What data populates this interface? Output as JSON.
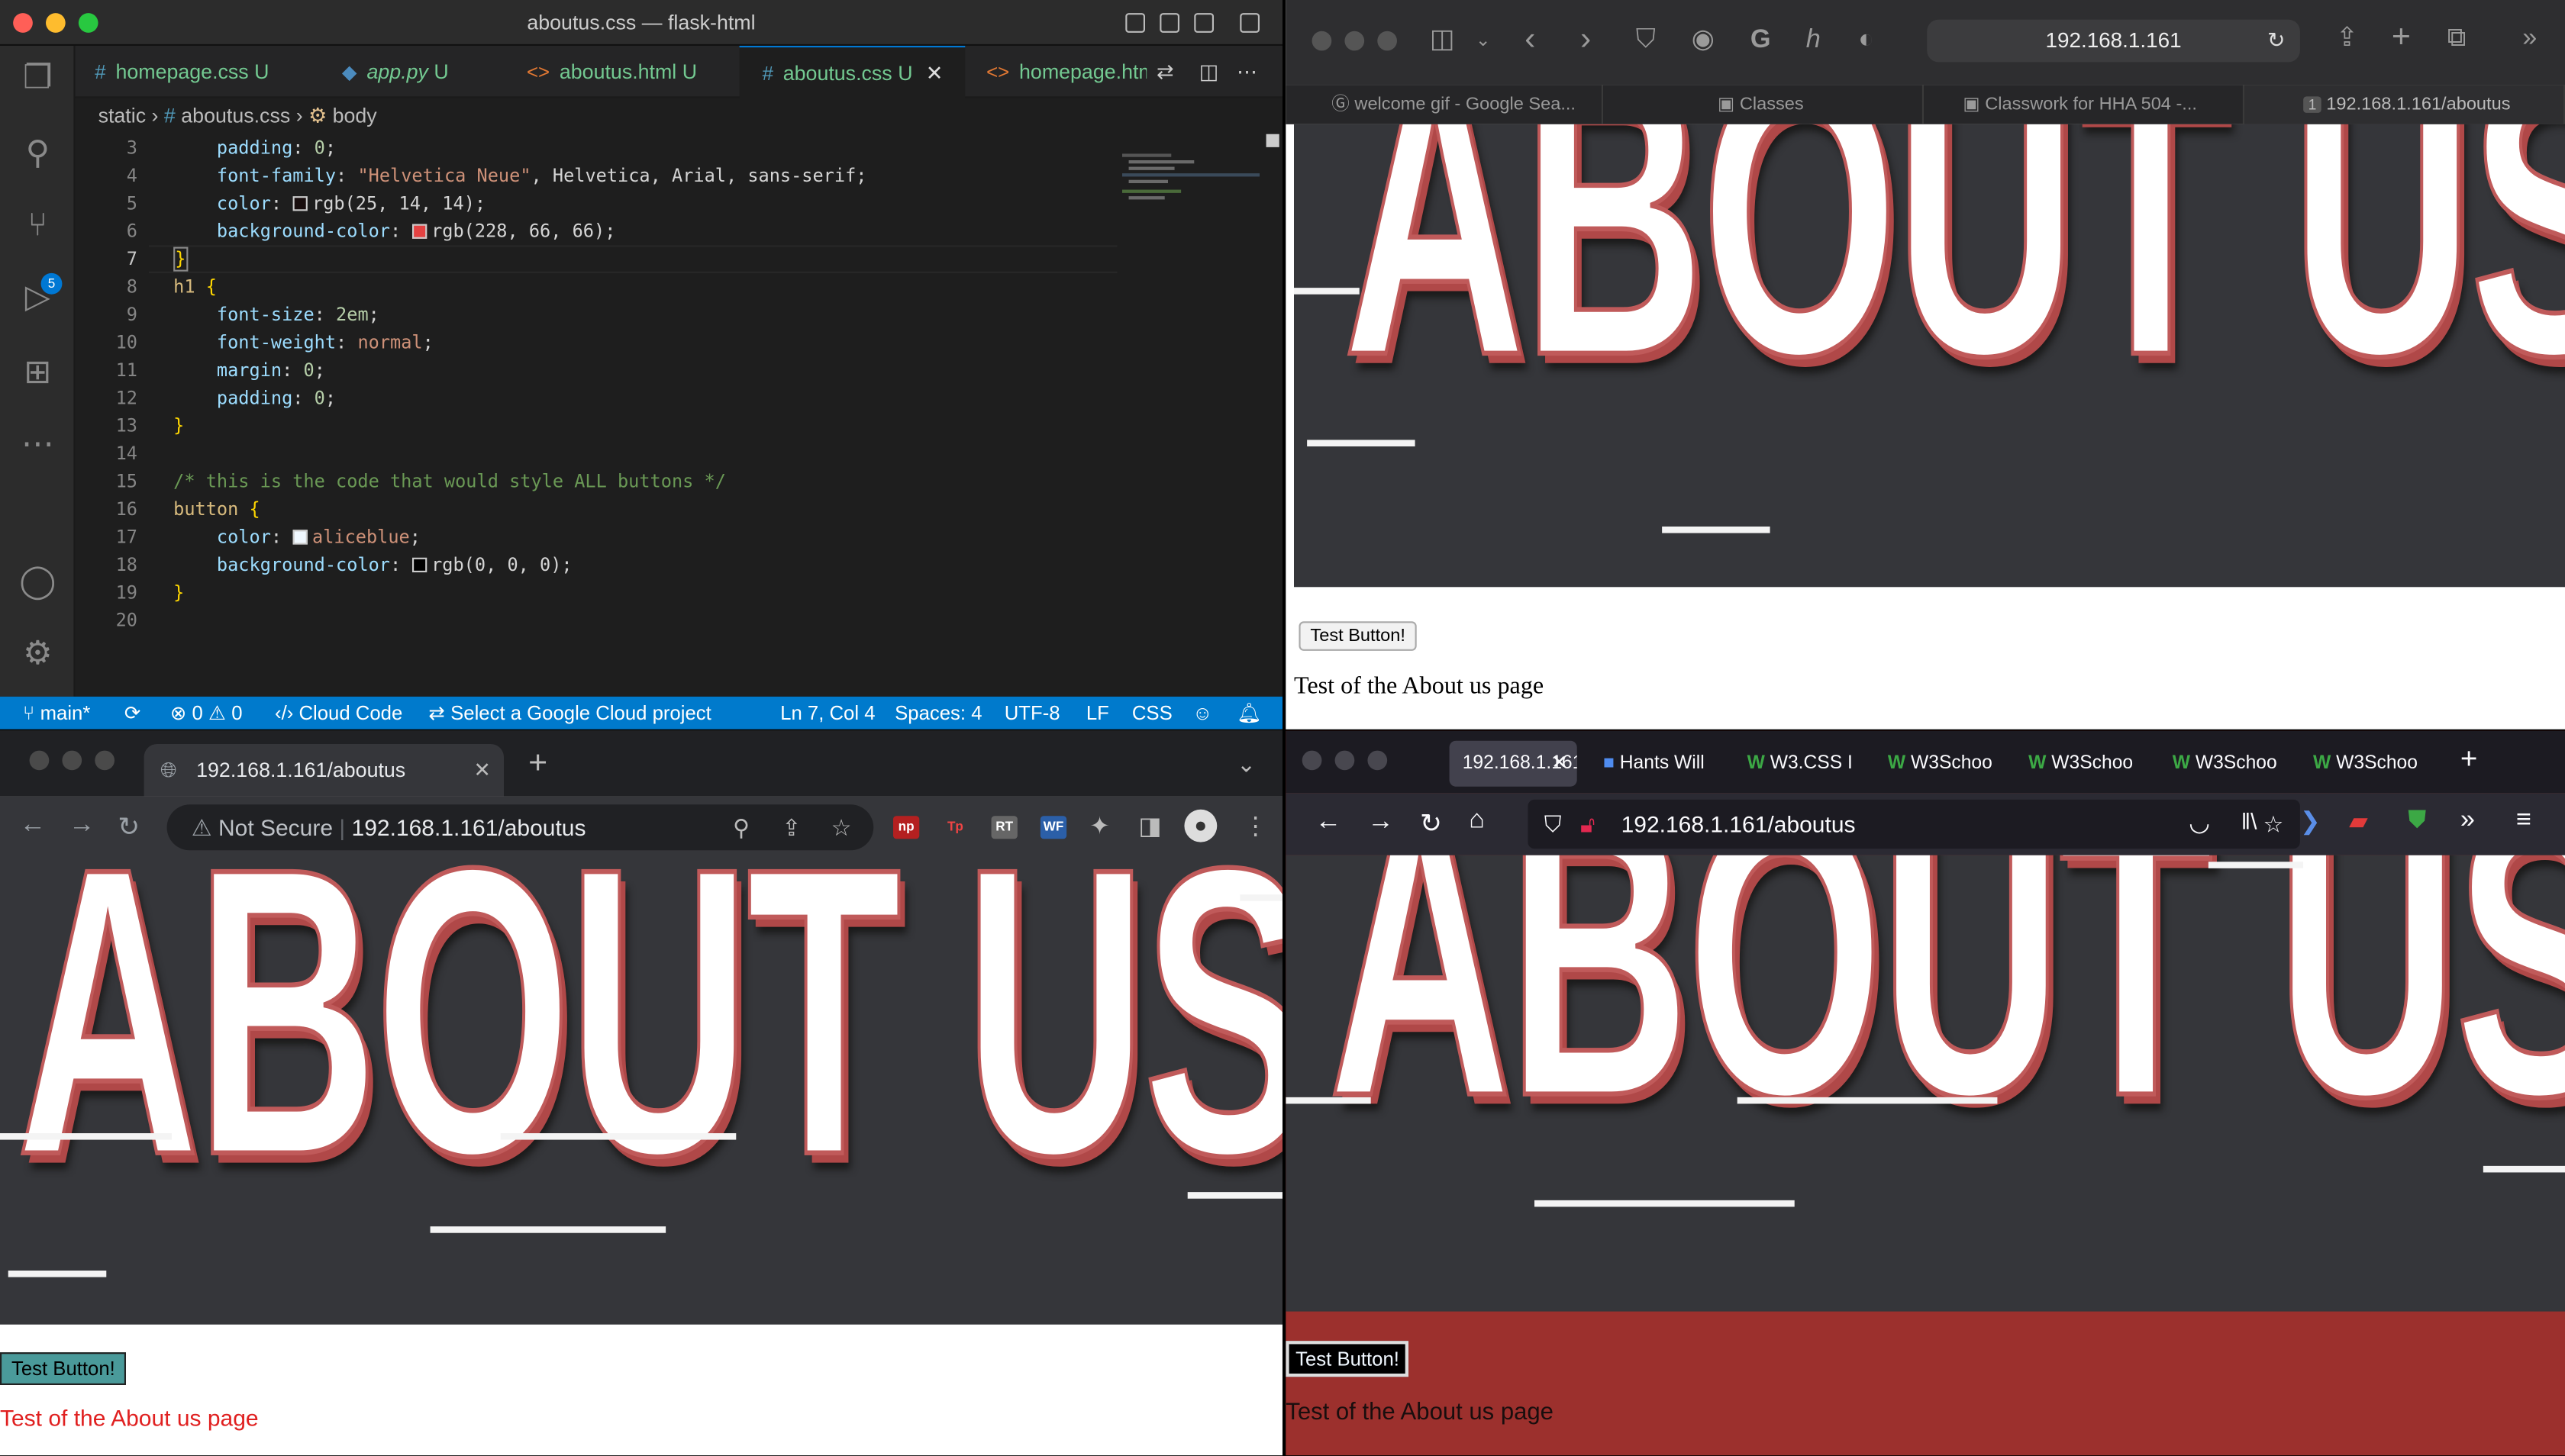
{
  "vscode": {
    "title": "aboutus.css — flask-html",
    "tabs": [
      {
        "icon": "#",
        "label": "homepage.css",
        "badge": "U"
      },
      {
        "icon": "py",
        "label": "app.py",
        "badge": "U"
      },
      {
        "icon": "<>",
        "label": "aboutus.html",
        "badge": "U"
      },
      {
        "icon": "#",
        "label": "aboutus.css",
        "badge": "U",
        "close": "✕"
      },
      {
        "icon": "<>",
        "label": "homepage.htm"
      }
    ],
    "breadcrumb": [
      "static",
      "#",
      "aboutus.css",
      "body"
    ],
    "scm_badge": "5",
    "line_numbers": [
      "3",
      "4",
      "5",
      "6",
      "7",
      "8",
      "9",
      "10",
      "11",
      "12",
      "13",
      "14",
      "15",
      "16",
      "17",
      "18",
      "19",
      "20"
    ],
    "code": {
      "l3_prop": "padding",
      "l3_val": "0",
      "l4_prop": "font-family",
      "l4_str": "\"Helvetica Neue\"",
      "l4_rest": ", Helvetica, Arial, sans-serif",
      "l5_prop": "color",
      "l5_val": "rgb(25, 14, 14)",
      "l6_prop": "background-color",
      "l6_val": "rgb(228, 66, 66)",
      "l7": "}",
      "l8_sel": "h1",
      "open": "{",
      "l9_prop": "font-size",
      "l9_val": "2em",
      "l10_prop": "font-weight",
      "l10_val": "normal",
      "l11_prop": "margin",
      "l11_val": "0",
      "l12_prop": "padding",
      "l12_val": "0",
      "close": "}",
      "l15_comment": "/* this is the code that would style ALL buttons */",
      "l16_sel": "button",
      "l17_prop": "color",
      "l17_val": "aliceblue",
      "l18_prop": "background-color",
      "l18_val": "rgb(0, 0, 0)"
    },
    "status": {
      "branch": "main*",
      "problems": "⊗ 0 ⚠ 0",
      "cloud_code": "Cloud Code",
      "gcp": "Select a Google Cloud project",
      "position": "Ln 7, Col 4",
      "spaces": "Spaces: 4",
      "encoding": "UTF-8",
      "eol": "LF",
      "language": "CSS"
    },
    "colors": {
      "accent": "#007acc",
      "swatch_l5": "#190e0e",
      "swatch_l6": "#e44242",
      "swatch_l17": "#f0f8ff",
      "swatch_l18": "#000000"
    }
  },
  "safari": {
    "url": "192.168.1.161",
    "tabs": [
      "welcome gif - Google Sea...",
      "Classes",
      "Classwork for HHA 504 -...",
      "192.168.1.161/aboutus"
    ],
    "active_tab_index_label": "1",
    "page": {
      "hero_text": "ABOUT US",
      "button_label": "Test Button!",
      "paragraph": "Test of the About us page"
    }
  },
  "chrome": {
    "tab_title": "192.168.1.161/aboutus",
    "security": "Not Secure",
    "url": "192.168.1.161/aboutus",
    "extensions": [
      "np",
      "Tp",
      "RT",
      "WF"
    ],
    "page": {
      "hero_text": "ABOUT US",
      "button_label": "Test Button!",
      "paragraph": "Test of the About us page"
    }
  },
  "firefox": {
    "tabs": [
      "192.168.1.161",
      "Hants Will",
      "W3.CSS I",
      "W3Schoo",
      "W3Schoo",
      "W3Schoo",
      "W3Schoo"
    ],
    "url": "192.168.1.161/aboutus",
    "page": {
      "hero_text": "ABOUT US",
      "button_label": "Test Button!",
      "paragraph": "Test of the About us page"
    },
    "page_bg": "#9c302d"
  }
}
